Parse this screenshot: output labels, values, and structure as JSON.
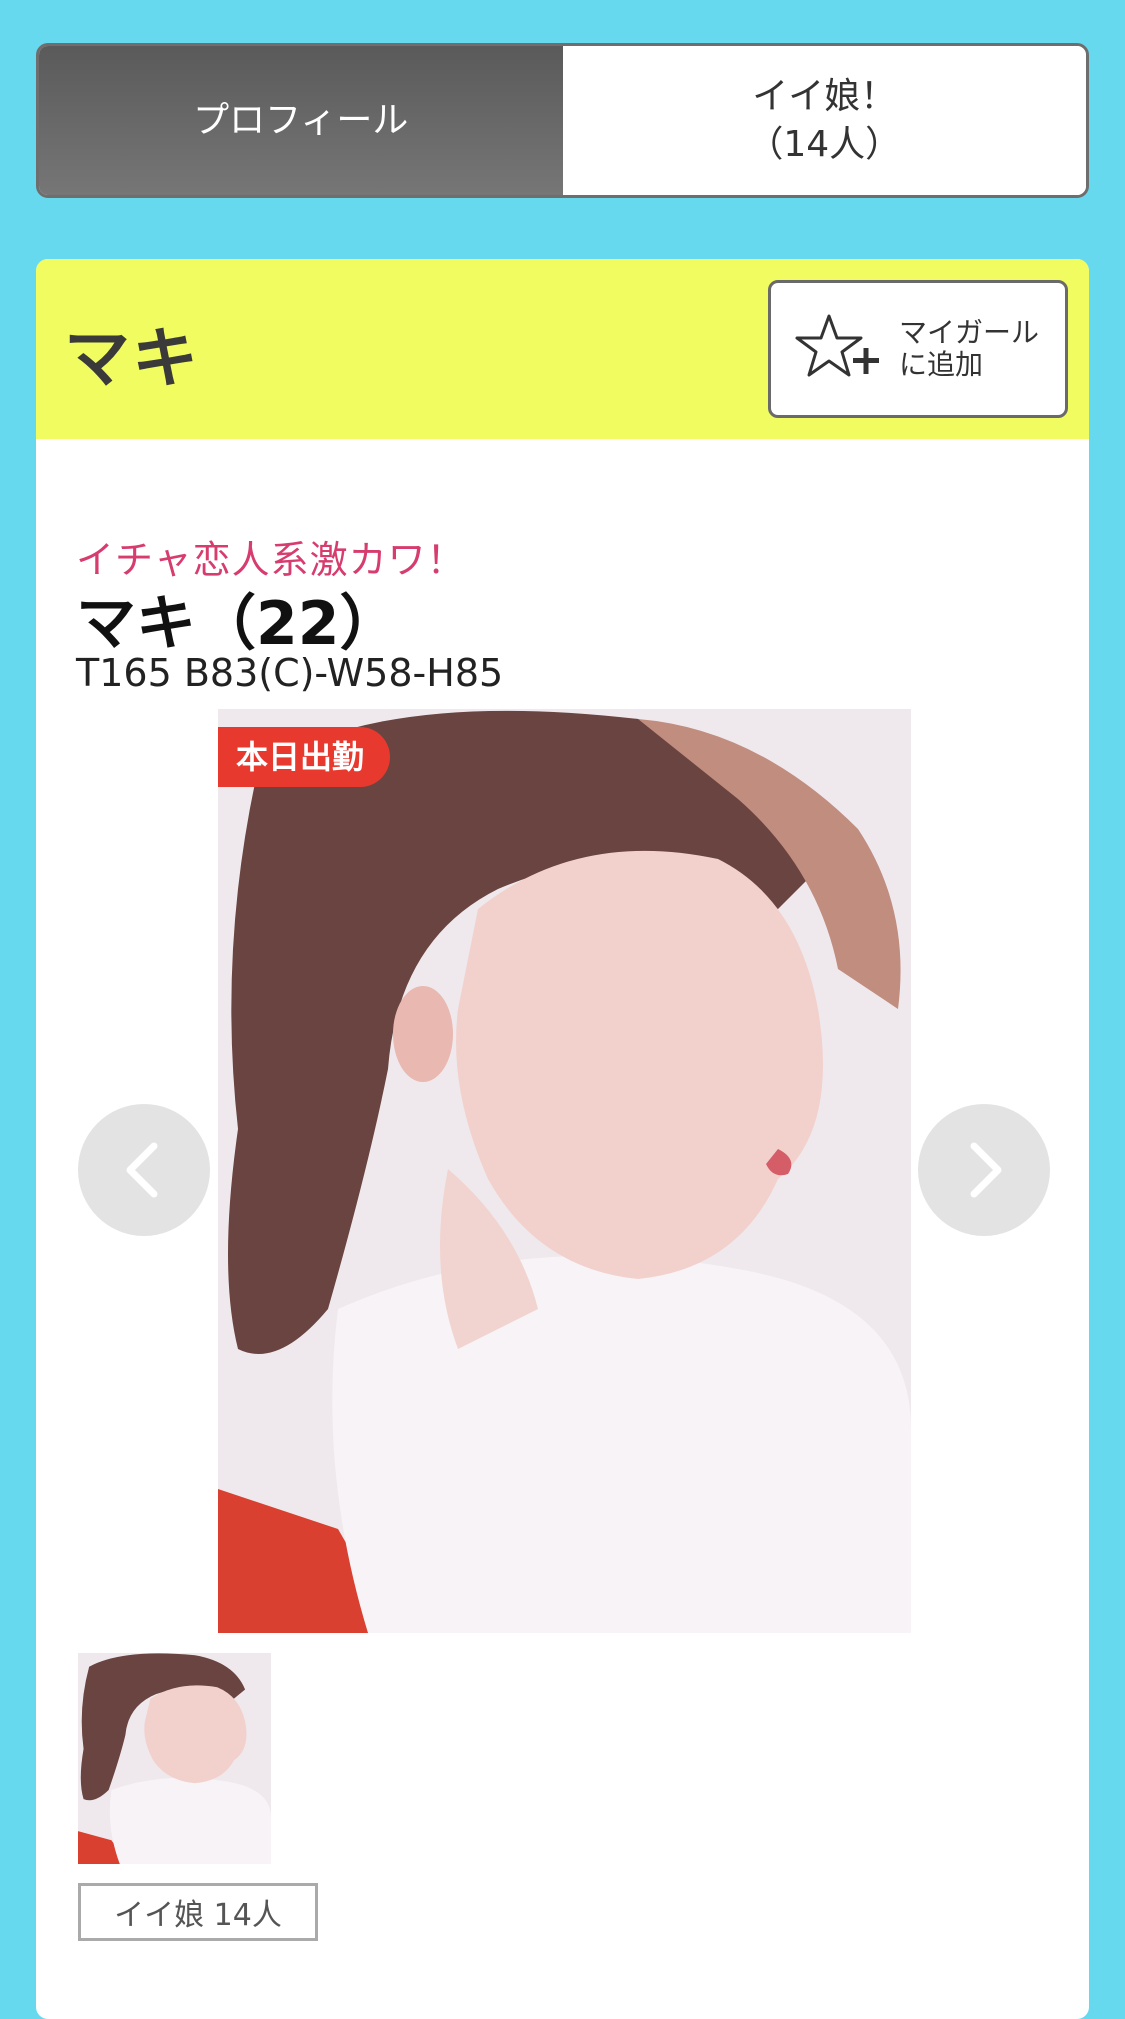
{
  "tabs": [
    {
      "label": "プロフィール",
      "active": true
    },
    {
      "label": "イイ娘！\n（14人）",
      "active": false
    }
  ],
  "header": {
    "name": "マキ",
    "mygirl_label": "マイガール\nに追加",
    "mygirl_icon": "star-plus-icon"
  },
  "profile": {
    "catch_copy": "イチャ恋人系激カワ！",
    "title": "マキ（22）",
    "specs": "T165 B83(C)-W58-H85",
    "badge": "本日出勤"
  },
  "gallery": {
    "prev_icon": "chevron-left-icon",
    "next_icon": "chevron-right-icon",
    "count_label": "イイ娘 14人"
  },
  "colors": {
    "background": "#66d9ee",
    "header_bg": "#f0fc5f",
    "catch_copy": "#d63c6e",
    "badge": "#e8392f",
    "active_tab": "#676767"
  }
}
